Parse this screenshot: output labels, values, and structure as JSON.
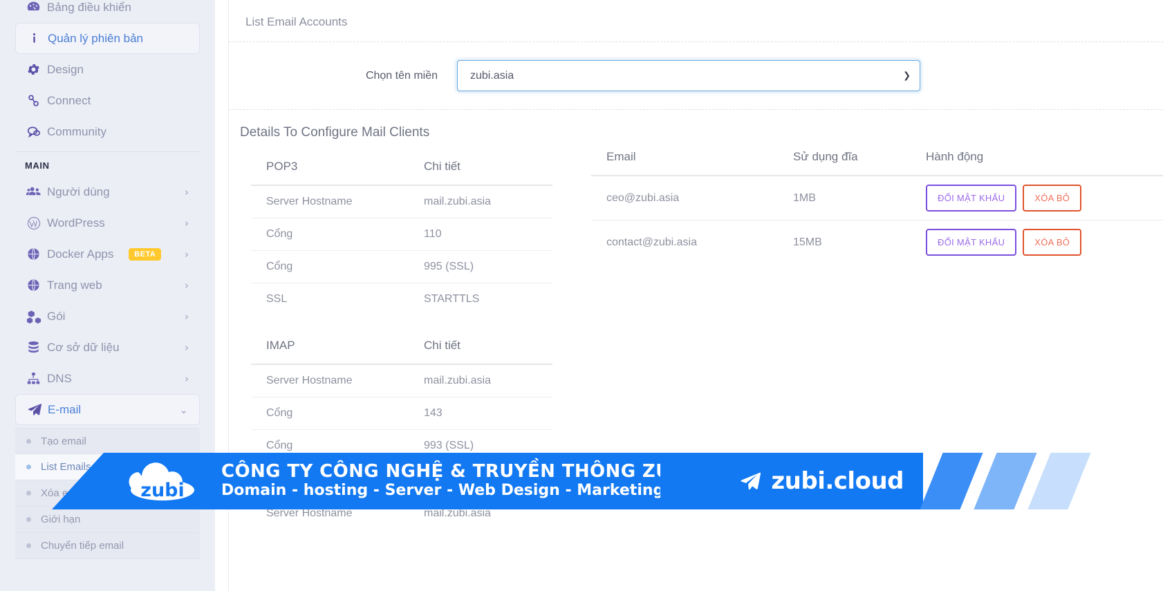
{
  "sidebar": {
    "items": [
      {
        "label": "Bảng điều khiển",
        "icon": "dashboard-icon",
        "active": false,
        "chevron": false
      },
      {
        "label": "Quản lý phiên bản",
        "icon": "info-icon",
        "active": true,
        "chevron": false
      },
      {
        "label": "Design",
        "icon": "gear-icon",
        "active": false,
        "chevron": false
      },
      {
        "label": "Connect",
        "icon": "link-icon",
        "active": false,
        "chevron": false
      },
      {
        "label": "Community",
        "icon": "chat-icon",
        "active": false,
        "chevron": false
      }
    ],
    "section_label": "MAIN",
    "main_items": [
      {
        "label": "Người dùng",
        "icon": "users-icon",
        "chevron": "›",
        "badge": ""
      },
      {
        "label": "WordPress",
        "icon": "wordpress-icon",
        "chevron": "›",
        "badge": ""
      },
      {
        "label": "Docker Apps",
        "icon": "globe-icon",
        "chevron": "›",
        "badge": "BETA"
      },
      {
        "label": "Trang web",
        "icon": "globe-icon",
        "chevron": "›",
        "badge": ""
      },
      {
        "label": "Gói",
        "icon": "boxes-icon",
        "chevron": "›",
        "badge": ""
      },
      {
        "label": "Cơ sở dữ liệu",
        "icon": "database-icon",
        "chevron": "›",
        "badge": ""
      },
      {
        "label": "DNS",
        "icon": "sitemap-icon",
        "chevron": "›",
        "badge": ""
      }
    ],
    "email_item": {
      "label": "E-mail",
      "icon": "paper-plane-icon",
      "chevron": "⌄"
    },
    "email_submenu": [
      {
        "label": "Tạo email",
        "selected": false
      },
      {
        "label": "List Emails",
        "selected": true
      },
      {
        "label": "Xóa email",
        "selected": false
      },
      {
        "label": "Giới hạn",
        "selected": false
      },
      {
        "label": "Chuyển tiếp email",
        "selected": false
      }
    ]
  },
  "main": {
    "card_title": "List Email Accounts",
    "filter_label": "Chọn tên miền",
    "domain_selected": "zubi.asia",
    "domain_options": [
      "zubi.asia"
    ],
    "details_title": "Details To Configure Mail Clients",
    "tables": [
      {
        "protocol": "POP3",
        "detail_header": "Chi tiết",
        "rows": [
          {
            "key": "Server Hostname",
            "value": "mail.zubi.asia"
          },
          {
            "key": "Cổng",
            "value": "110"
          },
          {
            "key": "Cổng",
            "value": "995 (SSL)"
          },
          {
            "key": "SSL",
            "value": "STARTTLS"
          }
        ]
      },
      {
        "protocol": "IMAP",
        "detail_header": "Chi tiết",
        "rows": [
          {
            "key": "Server Hostname",
            "value": "mail.zubi.asia"
          },
          {
            "key": "Cổng",
            "value": "143"
          },
          {
            "key": "Cổng",
            "value": "993 (SSL)"
          }
        ]
      },
      {
        "protocol": "",
        "detail_header": "",
        "rows": [
          {
            "key": "Server Hostname",
            "value": "mail.zubi.asia"
          }
        ]
      }
    ],
    "accounts_table": {
      "headers": [
        "Email",
        "Sử dụng đĩa",
        "Hành động"
      ],
      "rows": [
        {
          "email": "ceo@zubi.asia",
          "disk": "1MB",
          "btn_password": "ĐỔI MẬT KHẨU",
          "btn_delete": "XÓA BỎ"
        },
        {
          "email": "contact@zubi.asia",
          "disk": "15MB",
          "btn_password": "ĐỔI MẬT KHẨU",
          "btn_delete": "XÓA BỎ"
        }
      ]
    }
  },
  "banner": {
    "logo_text": "zubi",
    "line1": "CÔNG TY CÔNG NGHỆ & TRUYỀN THÔNG ZUBI",
    "line2": "Domain - hosting - Server - Web Design - Marketing",
    "brand": "zubi.cloud",
    "bg_color": "#1279f2"
  }
}
